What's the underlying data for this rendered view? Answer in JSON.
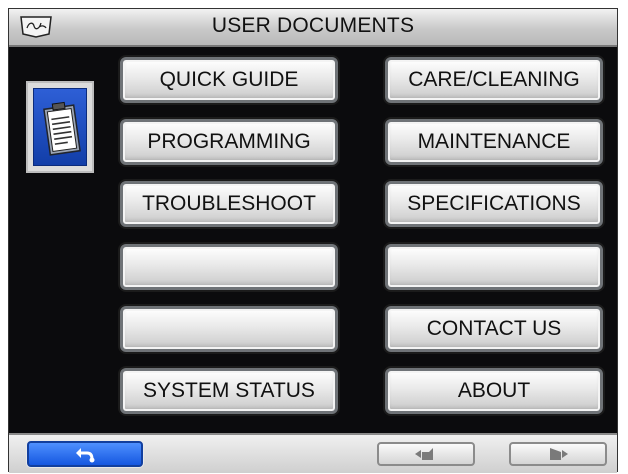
{
  "header": {
    "title": "USER DOCUMENTS",
    "logo_icon": "brand-shield-logo"
  },
  "sidebar": {
    "icon": "clipboard-document-icon",
    "accent": "#1f4fd0"
  },
  "menu": {
    "left": [
      "QUICK GUIDE",
      "PROGRAMMING",
      "TROUBLESHOOT",
      "",
      "",
      "SYSTEM STATUS"
    ],
    "right": [
      "CARE/CLEANING",
      "MAINTENANCE",
      "SPECIFICATIONS",
      "",
      "CONTACT US",
      "ABOUT"
    ]
  },
  "footer": {
    "back_icon": "back-arrow-icon",
    "prev_icon": "page-previous-icon",
    "next_icon": "page-next-icon"
  }
}
